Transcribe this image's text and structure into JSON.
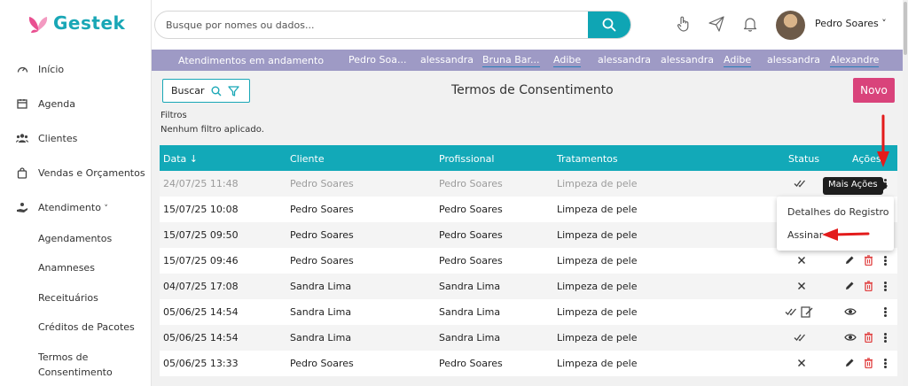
{
  "brand": {
    "name": "Gestek",
    "color": "#19a7b6"
  },
  "sidebar": {
    "items": [
      {
        "label": "Início",
        "icon": "dashboard-gauge-icon"
      },
      {
        "label": "Agenda",
        "icon": "calendar-icon"
      },
      {
        "label": "Clientes",
        "icon": "users-icon"
      },
      {
        "label": "Vendas e Orçamentos",
        "icon": "shopping-bag-icon"
      },
      {
        "label": "Atendimento",
        "icon": "hand-service-icon",
        "expanded": true
      }
    ],
    "sub_items": [
      "Agendamentos",
      "Anamneses",
      "Receituários",
      "Créditos de Pacotes",
      "Termos de",
      "Consentimento"
    ]
  },
  "topbar": {
    "search_placeholder": "Busque por nomes ou dados...",
    "icons": [
      "hand-pointer-icon",
      "send-icon",
      "bell-icon",
      "search-icon"
    ],
    "user_name": "Pedro Soares ˅"
  },
  "strip": {
    "title": "Atendimentos em andamento",
    "items": [
      "Pedro Soa...",
      "alessandra",
      "Bruna Bar...",
      "Adibe",
      "alessandra",
      "alessandra",
      "Adibe",
      "alessandra",
      "Alexandre"
    ]
  },
  "page": {
    "search_button": "Buscar",
    "title": "Termos de Consentimento",
    "new_button": "Novo",
    "filters_label": "Filtros",
    "filters_value": "Nenhum filtro aplicado."
  },
  "table": {
    "headers": {
      "date": "Data ↓",
      "client": "Cliente",
      "professional": "Profissional",
      "treatment": "Tratamentos",
      "status": "Status",
      "actions": "Ações"
    },
    "rows": [
      {
        "date": "24/07/25 11:48",
        "client": "Pedro Soares",
        "professional": "Pedro Soares",
        "treatment": "Limpeza de pele",
        "status": "signed",
        "actions": []
      },
      {
        "date": "15/07/25 10:08",
        "client": "Pedro Soares",
        "professional": "Pedro Soares",
        "treatment": "Limpeza de pele",
        "status": "",
        "actions": []
      },
      {
        "date": "15/07/25 09:50",
        "client": "Pedro Soares",
        "professional": "Pedro Soares",
        "treatment": "Limpeza de pele",
        "status": "",
        "actions": []
      },
      {
        "date": "15/07/25 09:46",
        "client": "Pedro Soares",
        "professional": "Pedro Soares",
        "treatment": "Limpeza de pele",
        "status": "unsigned",
        "actions": [
          "edit",
          "delete"
        ]
      },
      {
        "date": "04/07/25 17:08",
        "client": "Sandra Lima",
        "professional": "Sandra Lima",
        "treatment": "Limpeza de pele",
        "status": "unsigned",
        "actions": [
          "edit",
          "delete"
        ]
      },
      {
        "date": "05/06/25 14:54",
        "client": "Sandra Lima",
        "professional": "Sandra Lima",
        "treatment": "Limpeza de pele",
        "status": "signed-signature",
        "actions": [
          "view"
        ]
      },
      {
        "date": "05/06/25 14:54",
        "client": "Sandra Lima",
        "professional": "Sandra Lima",
        "treatment": "Limpeza de pele",
        "status": "signed",
        "actions": [
          "view",
          "delete"
        ]
      },
      {
        "date": "05/06/25 13:33",
        "client": "Pedro Soares",
        "professional": "Pedro Soares",
        "treatment": "Limpeza de pele",
        "status": "unsigned",
        "actions": [
          "edit",
          "delete"
        ]
      }
    ]
  },
  "tooltip": "Mais Ações",
  "context_menu": {
    "items": [
      "Detalhes do Registro",
      "Assinar"
    ]
  },
  "colors": {
    "accent": "#12a9b8",
    "strip": "#9e9ac5",
    "primary_button": "#d9437b",
    "annotation_arrow": "#e31b1b",
    "delete_icon": "#e04040"
  }
}
